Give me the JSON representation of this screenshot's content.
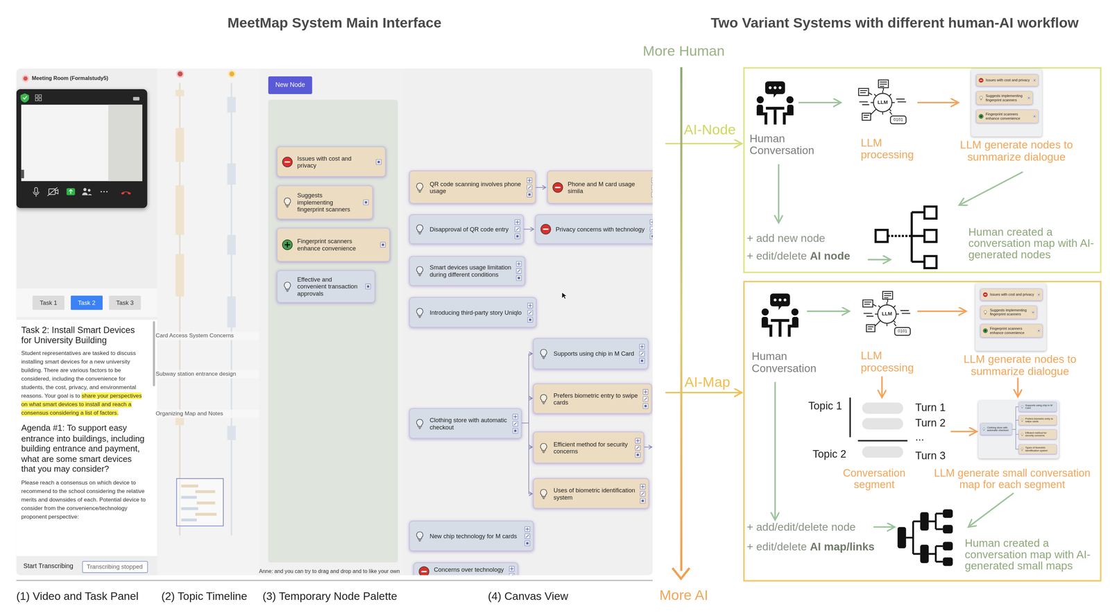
{
  "headings": {
    "main_interface": "MeetMap System Main Interface",
    "variants": "Two Variant Systems with different human-AI workflow"
  },
  "meeting": {
    "room": "Meeting Room (Formalstudy5)"
  },
  "task_tabs": [
    {
      "label": "Task 1",
      "selected": false
    },
    {
      "label": "Task 2",
      "selected": true
    },
    {
      "label": "Task 3",
      "selected": false
    }
  ],
  "task": {
    "title": "Task 2: Install Smart Devices for University Building",
    "intro": "Student representatives are tasked to discuss installing smart devices for a new university building. There are various factors to be considered, including the convenience for students, the cost, privacy, and environmental reasons. Your goal is to ",
    "highlight": "share your perspectives on what smart devices to install and reach a consensus considering a list of factors.",
    "agenda": "Agenda #1: To support easy entrance into buildings, including building entrance and payment, what are some smart devices that you may consider?",
    "details": "Please reach a consensus on which device to recommend to the school considering the relative merits and downsides of each. Potential device to consider from the convenience/technology proponent perspective:"
  },
  "transcribe": {
    "start": "Start Transcribing",
    "status": "Transcribing stopped"
  },
  "timeline": {
    "topics": [
      "Card Access System Concerns",
      "Subway station entrance design",
      "Organizing Map and Notes"
    ]
  },
  "new_node_button": "New Node",
  "palette_nodes": [
    {
      "text": "Issues with cost and privacy",
      "kind": "minus",
      "color": "#ecdcc2"
    },
    {
      "text": "Suggests implementing fingerprint scanners",
      "kind": "bulb",
      "color": "#ecdcc2"
    },
    {
      "text": "Fingerprint scanners enhance convenience",
      "kind": "plus",
      "color": "#ecdcc2"
    },
    {
      "text": "Effective and convenient transaction approvals",
      "kind": "bulb",
      "color": "#d6dde6"
    }
  ],
  "canvas_nodes": [
    {
      "text": "QR code scanning involves phone usage",
      "kind": "bulb",
      "color": "#ecdcc2"
    },
    {
      "text": "Phone and M card usage simila",
      "kind": "minus",
      "color": "#ecdcc2"
    },
    {
      "text": "Disapproval of QR code entry",
      "kind": "bulb",
      "color": "#d6dde6"
    },
    {
      "text": "Privacy concerns with technology",
      "kind": "minus",
      "color": "#d6dde6"
    },
    {
      "text": "Smart devices usage limitation during different conditions",
      "kind": "bulb",
      "color": "#d6dde6"
    },
    {
      "text": "Introducing third-party story Uniqlo",
      "kind": "bulb",
      "color": "#d6dde6"
    },
    {
      "text": "Clothing store with automatic checkout",
      "kind": "bulb",
      "color": "#d6dde6"
    },
    {
      "text": "Supports using chip in M Card",
      "kind": "bulb",
      "color": "#d6dde6"
    },
    {
      "text": "Prefers biometric entry to swipe cards",
      "kind": "bulb",
      "color": "#ecdcc2"
    },
    {
      "text": "Efficient method for security concerns",
      "kind": "bulb",
      "color": "#ecdcc2"
    },
    {
      "text": "Uses of biometric identification system",
      "kind": "bulb",
      "color": "#ecdcc2"
    },
    {
      "text": "New chip technology for M cards",
      "kind": "bulb",
      "color": "#d6dde6"
    },
    {
      "text": "Concerns over technology",
      "kind": "minus",
      "color": "#d6dde6"
    }
  ],
  "caption": "Anne: and you can try to drag and drop and to like your own",
  "panel_labels": [
    "(1) Video and Task Panel",
    "(2) Topic Timeline",
    "(3) Temporary Node Palette",
    "(4) Canvas View"
  ],
  "axis": {
    "top": "More Human",
    "bottom": "More AI"
  },
  "variants": {
    "ai_node": {
      "label": "AI-Node",
      "conversation": "Human Conversation",
      "llm_icon": "LLM",
      "llm_bits": "0101",
      "processing": "LLM processing",
      "generate": "LLM generate nodes to summarize dialogue",
      "thumb_nodes": [
        {
          "text": "Issues with cost and privacy",
          "kind": "minus",
          "color": "#ecdcc2"
        },
        {
          "text": "Suggests implementing fingerprint scanners",
          "kind": "bulb",
          "color": "#ecdcc2"
        },
        {
          "text": "Fingerprint scanners enhance convenience",
          "kind": "plus",
          "color": "#ecdcc2"
        }
      ],
      "actions": [
        {
          "text": "+ add new node"
        },
        {
          "text": "+ edit/delete ",
          "bold": "AI node"
        }
      ],
      "result": "Human created a conversation map with AI-generated nodes"
    },
    "ai_map": {
      "label": "AI-Map",
      "conversation": "Human Conversation",
      "llm_icon": "LLM",
      "llm_bits": "0101",
      "processing": "LLM processing",
      "generate": "LLM generate nodes to summarize dialogue",
      "thumb_nodes": [
        {
          "text": "Issues with cost and privacy",
          "kind": "minus",
          "color": "#ecdcc2"
        },
        {
          "text": "Suggests implementing fingerprint scanners",
          "kind": "bulb",
          "color": "#ecdcc2"
        },
        {
          "text": "Fingerprint scanners enhance convenience",
          "kind": "plus",
          "color": "#ecdcc2"
        }
      ],
      "topics": [
        "Topic 1",
        "Topic 2"
      ],
      "turns": [
        "Turn 1",
        "Turn 2",
        "...",
        "Turn 3"
      ],
      "segment": "Conversation segment",
      "segment_map": "LLM generate small conversation map for each segment",
      "small_map": {
        "root": {
          "text": "Clothing store with automatic checkout",
          "kind": "bulb",
          "color": "#d6dde6"
        },
        "children": [
          {
            "text": "Supports using chip in M Card",
            "kind": "bulb",
            "color": "#d6dde6"
          },
          {
            "text": "Prefers biometric entry to swipe cards",
            "kind": "bulb",
            "color": "#ecdcc2"
          },
          {
            "text": "Efficient method for security concerns",
            "kind": "bulb",
            "color": "#ecdcc2"
          },
          {
            "text": "Types of biometric identification system",
            "kind": "bulb",
            "color": "#ecdcc2"
          }
        ]
      },
      "actions": [
        {
          "text": "+ add/edit/delete node"
        },
        {
          "text": "+ edit/delete ",
          "bold": "AI map/links"
        }
      ],
      "result": "Human created a conversation map with AI-generated small maps"
    }
  }
}
